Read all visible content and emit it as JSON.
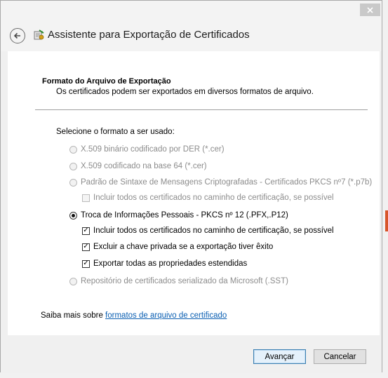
{
  "window": {
    "title": "Assistente para Exportação de Certificados"
  },
  "section": {
    "title": "Formato do Arquivo de Exportação",
    "description": "Os certificados podem ser exportados em diversos formatos de arquivo."
  },
  "format": {
    "prompt": "Selecione o formato a ser usado:",
    "options": [
      {
        "label": "X.509 binário codificado por DER (*.cer)",
        "selected": false,
        "enabled": false
      },
      {
        "label": "X.509 codificado na base 64 (*.cer)",
        "selected": false,
        "enabled": false
      },
      {
        "label": "Padrão de Sintaxe de Mensagens Criptografadas - Certificados PKCS nº7 (*.p7b)",
        "selected": false,
        "enabled": false
      },
      {
        "label": "Troca de Informações Pessoais - PKCS nº 12 (.PFX,.P12)",
        "selected": true,
        "enabled": true
      },
      {
        "label": "Repositório de certificados serializado da Microsoft (.SST)",
        "selected": false,
        "enabled": false
      }
    ],
    "p7b_include_chain": {
      "label": "Incluir todos os certificados no caminho de certificação, se possível",
      "checked": false,
      "enabled": false
    },
    "pfx_checks": [
      {
        "label": "Incluir todos os certificados no caminho de certificação, se possível",
        "checked": true
      },
      {
        "label": "Excluir a chave privada se a exportação tiver êxito",
        "checked": true
      },
      {
        "label": "Exportar todas as propriedades estendidas",
        "checked": true
      }
    ]
  },
  "learn_more": {
    "prefix": "Saiba mais sobre ",
    "link": "formatos de arquivo de certificado"
  },
  "buttons": {
    "next": "Avançar",
    "cancel": "Cancelar"
  },
  "colors": {
    "link": "#0b5fb2",
    "accent_border": "#3c7fb1"
  }
}
